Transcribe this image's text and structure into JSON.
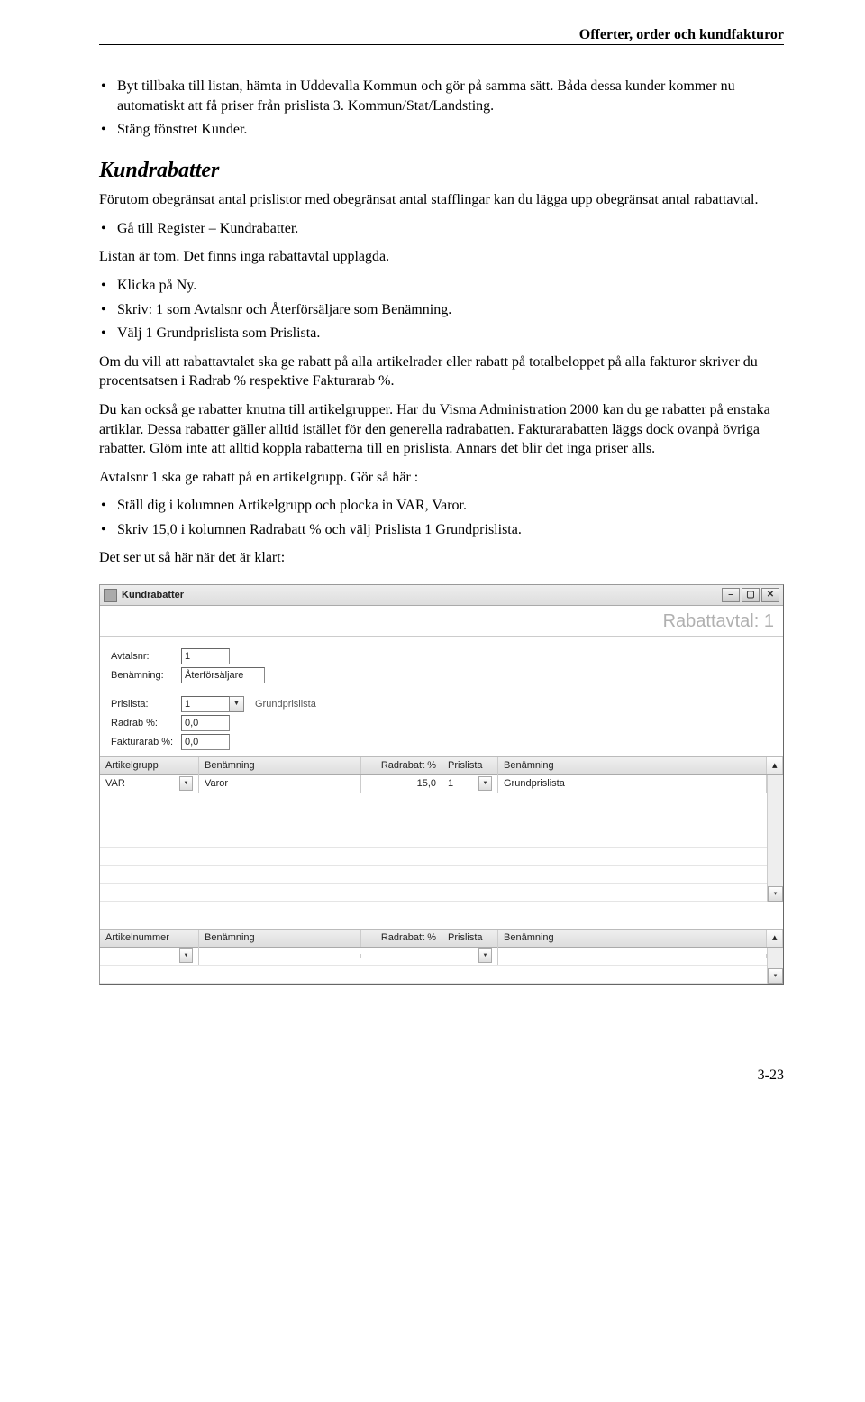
{
  "header": "Offerter, order och kundfakturor",
  "bullets1": [
    "Byt tillbaka till listan, hämta in Uddevalla Kommun och gör på samma sätt. Båda dessa kunder kommer nu automatiskt att få priser från prislista 3. Kommun/Stat/Landsting.",
    "Stäng fönstret Kunder."
  ],
  "section": "Kundrabatter",
  "intro": "Förutom obegränsat antal prislistor med obegränsat antal stafflingar kan du lägga upp obegränsat antal rabattavtal.",
  "listA": [
    "Gå till Register – Kundrabatter."
  ],
  "paraA": "Listan är tom. Det finns inga rabattavtal upplagda.",
  "listB": [
    "Klicka på Ny.",
    "Skriv: 1 som Avtalsnr och Återförsäljare som Benämning.",
    "Välj 1 Grundprislista som Prislista."
  ],
  "paraB": "Om du vill att rabattavtalet ska ge rabatt på alla artikelrader eller rabatt på totalbeloppet på alla fakturor skriver du procentsatsen i Radrab % respektive Fakturarab %.",
  "paraC": "Du kan också ge rabatter knutna till artikelgrupper. Har du Visma Administration 2000 kan du ge rabatter på enstaka artiklar. Dessa rabatter gäller alltid istället för den generella radrabatten. Fakturarabatten läggs dock ovanpå övriga rabatter. Glöm inte att alltid koppla rabatterna till en prislista. Annars det blir det inga priser alls.",
  "paraD": "Avtalsnr 1 ska ge rabatt på en artikelgrupp. Gör så här :",
  "listC": [
    "Ställ dig i kolumnen Artikelgrupp och plocka in VAR, Varor.",
    "Skriv 15,0 i kolumnen Radrabatt % och välj Prislista 1 Grundprislista."
  ],
  "paraE": "Det ser ut så här när det är klart:",
  "window": {
    "title": "Kundrabatter",
    "subtitle": "Rabattavtal: 1",
    "fields": {
      "avtalsnr_label": "Avtalsnr:",
      "avtalsnr": "1",
      "benamning_label": "Benämning:",
      "benamning": "Återförsäljare",
      "prislista_label": "Prislista:",
      "prislista": "1",
      "prislista_name": "Grundprislista",
      "radrab_label": "Radrab %:",
      "radrab": "0,0",
      "fakturarab_label": "Fakturarab %:",
      "fakturarab": "0,0"
    },
    "grid1": {
      "headers": [
        "Artikelgrupp",
        "Benämning",
        "Radrabatt %",
        "Prislista",
        "Benämning"
      ],
      "row": {
        "art": "VAR",
        "ben": "Varor",
        "rad": "15,0",
        "pris": "1",
        "ben2": "Grundprislista"
      }
    },
    "grid2": {
      "headers": [
        "Artikelnummer",
        "Benämning",
        "Radrabatt %",
        "Prislista",
        "Benämning"
      ]
    }
  },
  "footer": "3-23"
}
